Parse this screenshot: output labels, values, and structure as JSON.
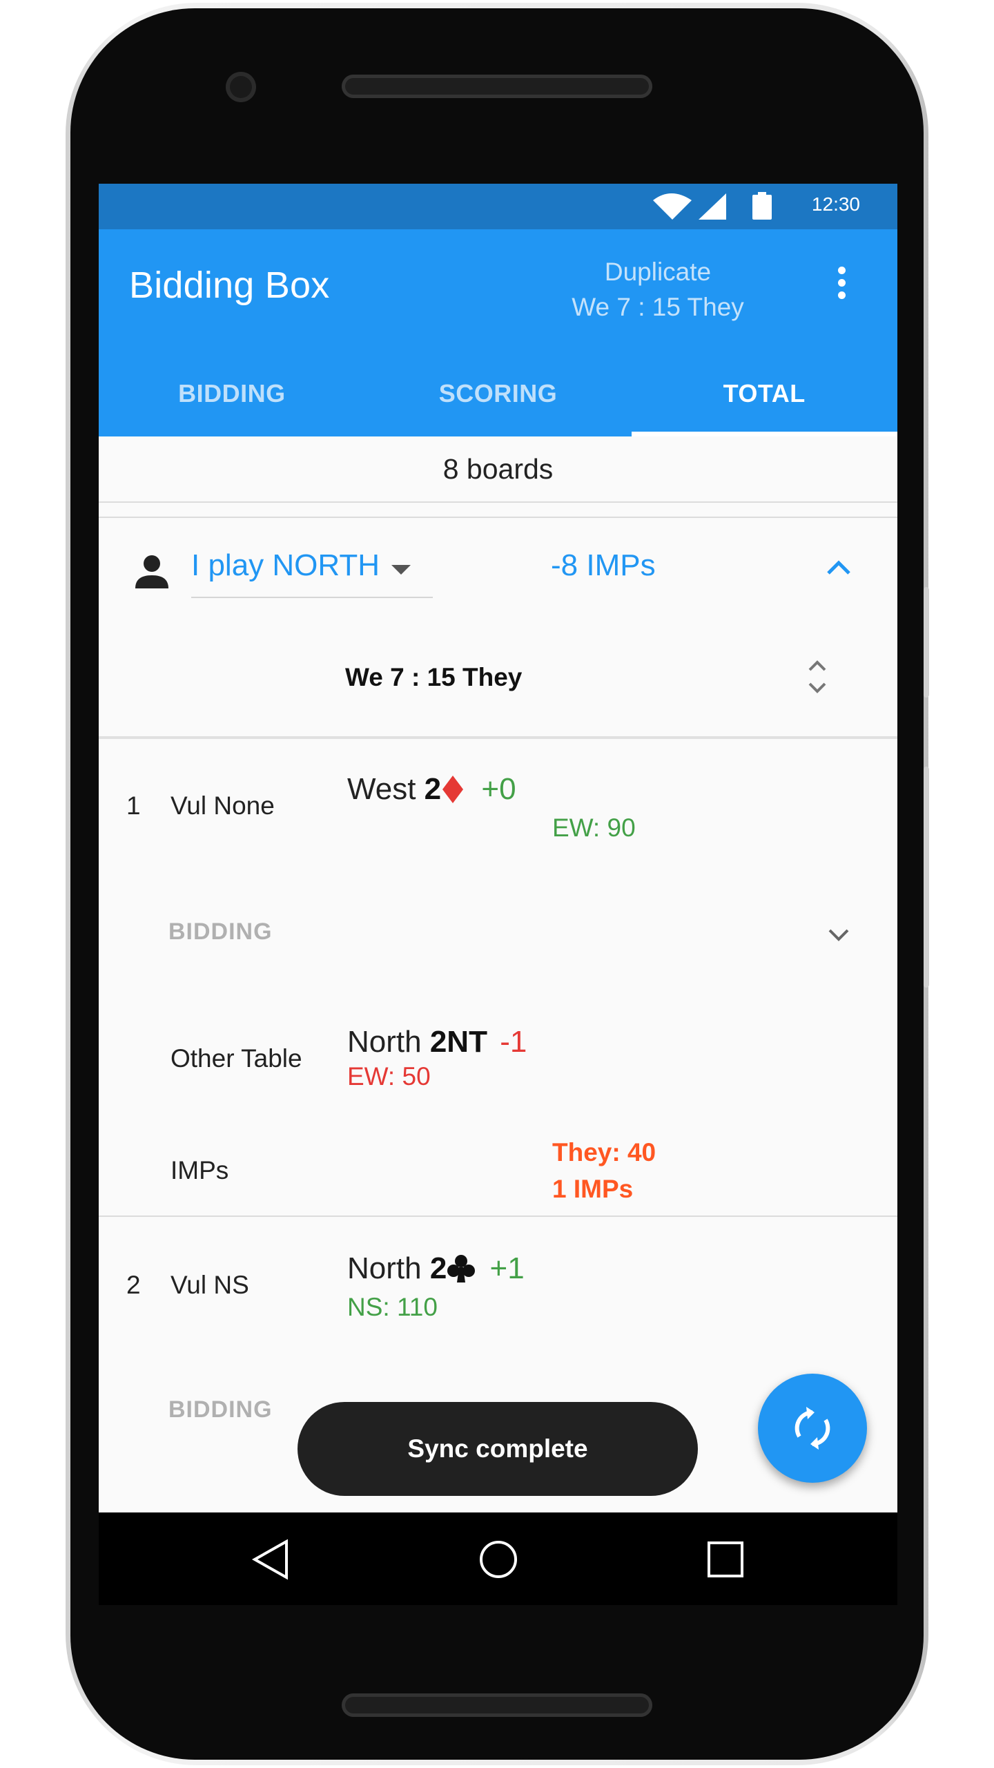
{
  "status_bar": {
    "time": "12:30"
  },
  "app_bar": {
    "title": "Bidding Box",
    "mode": "Duplicate",
    "score_summary": "We 7 : 15 They",
    "menu_icon": "more-vert-icon"
  },
  "tabs": [
    {
      "label": "BIDDING",
      "active": false
    },
    {
      "label": "SCORING",
      "active": false
    },
    {
      "label": "TOTAL",
      "active": true
    }
  ],
  "boards_count": "8 boards",
  "summary": {
    "play_position": "I play NORTH",
    "imps_total": "-8 IMPs",
    "we_they": "We 7 : 15 They"
  },
  "boards": [
    {
      "number": "1",
      "vulnerability": "Vul None",
      "declarer": "West",
      "level": "2",
      "suit": "diamond",
      "suit_symbol": "♦",
      "result": "+0",
      "score": "EW: 90",
      "bidding_label": "BIDDING",
      "other_table": {
        "label": "Other Table",
        "declarer": "North",
        "level": "2NT",
        "result": "-1",
        "score": "EW: 50"
      },
      "imps": {
        "label": "IMPs",
        "line1": "They: 40",
        "line2": "1 IMPs"
      }
    },
    {
      "number": "2",
      "vulnerability": "Vul NS",
      "declarer": "North",
      "level": "2",
      "suit": "club",
      "suit_symbol": "♣",
      "result": "+1",
      "score": "NS: 110",
      "bidding_label": "BIDDING"
    }
  ],
  "snackbar": {
    "message": "Sync complete"
  },
  "fab": {
    "icon": "sync-icon"
  },
  "colors": {
    "primary": "#2196f3",
    "primary_dark": "#1c77c3",
    "positive": "#43a047",
    "negative": "#e53935",
    "imps_accent": "#ff5722"
  }
}
